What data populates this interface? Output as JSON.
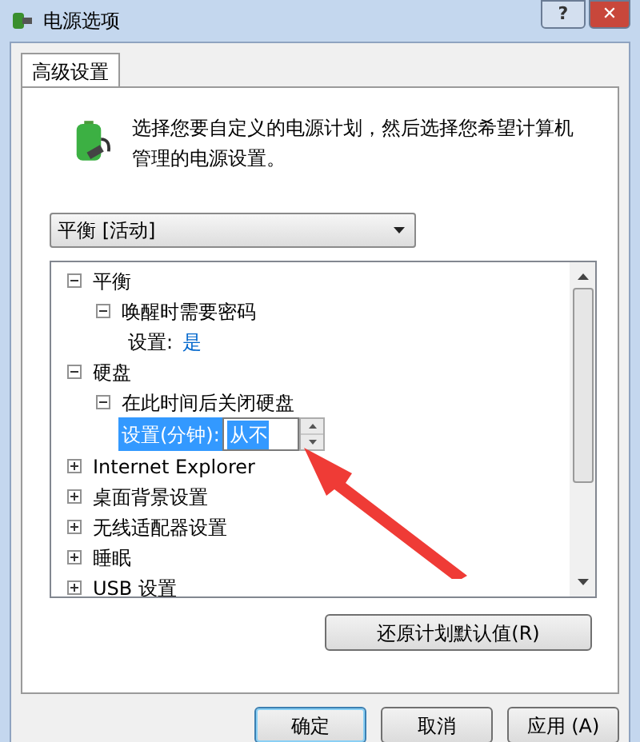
{
  "window": {
    "title": "电源选项",
    "buttons": [
      "?",
      "✕"
    ]
  },
  "tabs": [
    {
      "label": "高级设置",
      "selected": true
    }
  ],
  "intro": "选择您要自定义的电源计划，然后选择您希望计算机管理的电源设置。",
  "plan_select": {
    "value": "平衡 [活动]"
  },
  "tree": [
    {
      "kind": "group",
      "label": "平衡",
      "expanded": true,
      "children": [
        {
          "kind": "group",
          "label": "唤醒时需要密码",
          "expanded": true,
          "children": [
            {
              "kind": "value",
              "label": "设置:",
              "value": "是",
              "selected": false
            }
          ]
        }
      ]
    },
    {
      "kind": "group",
      "label": "硬盘",
      "expanded": true,
      "children": [
        {
          "kind": "group",
          "label": "在此时间后关闭硬盘",
          "expanded": true,
          "children": [
            {
              "kind": "edit",
              "label": "设置(分钟):",
              "value": "从不",
              "selected": true
            }
          ]
        }
      ]
    },
    {
      "kind": "group",
      "label": "Internet Explorer",
      "expanded": false
    },
    {
      "kind": "group",
      "label": "桌面背景设置",
      "expanded": false
    },
    {
      "kind": "group",
      "label": "无线适配器设置",
      "expanded": false
    },
    {
      "kind": "group",
      "label": "睡眠",
      "expanded": false
    },
    {
      "kind": "group",
      "label": "USB 设置",
      "expanded": false
    }
  ],
  "restore_button": "还原计划默认值(R)",
  "buttons": [
    {
      "label": "确定",
      "selected": true
    },
    {
      "label": "取消",
      "selected": false
    },
    {
      "label": "应用 (A)",
      "selected": false
    }
  ]
}
